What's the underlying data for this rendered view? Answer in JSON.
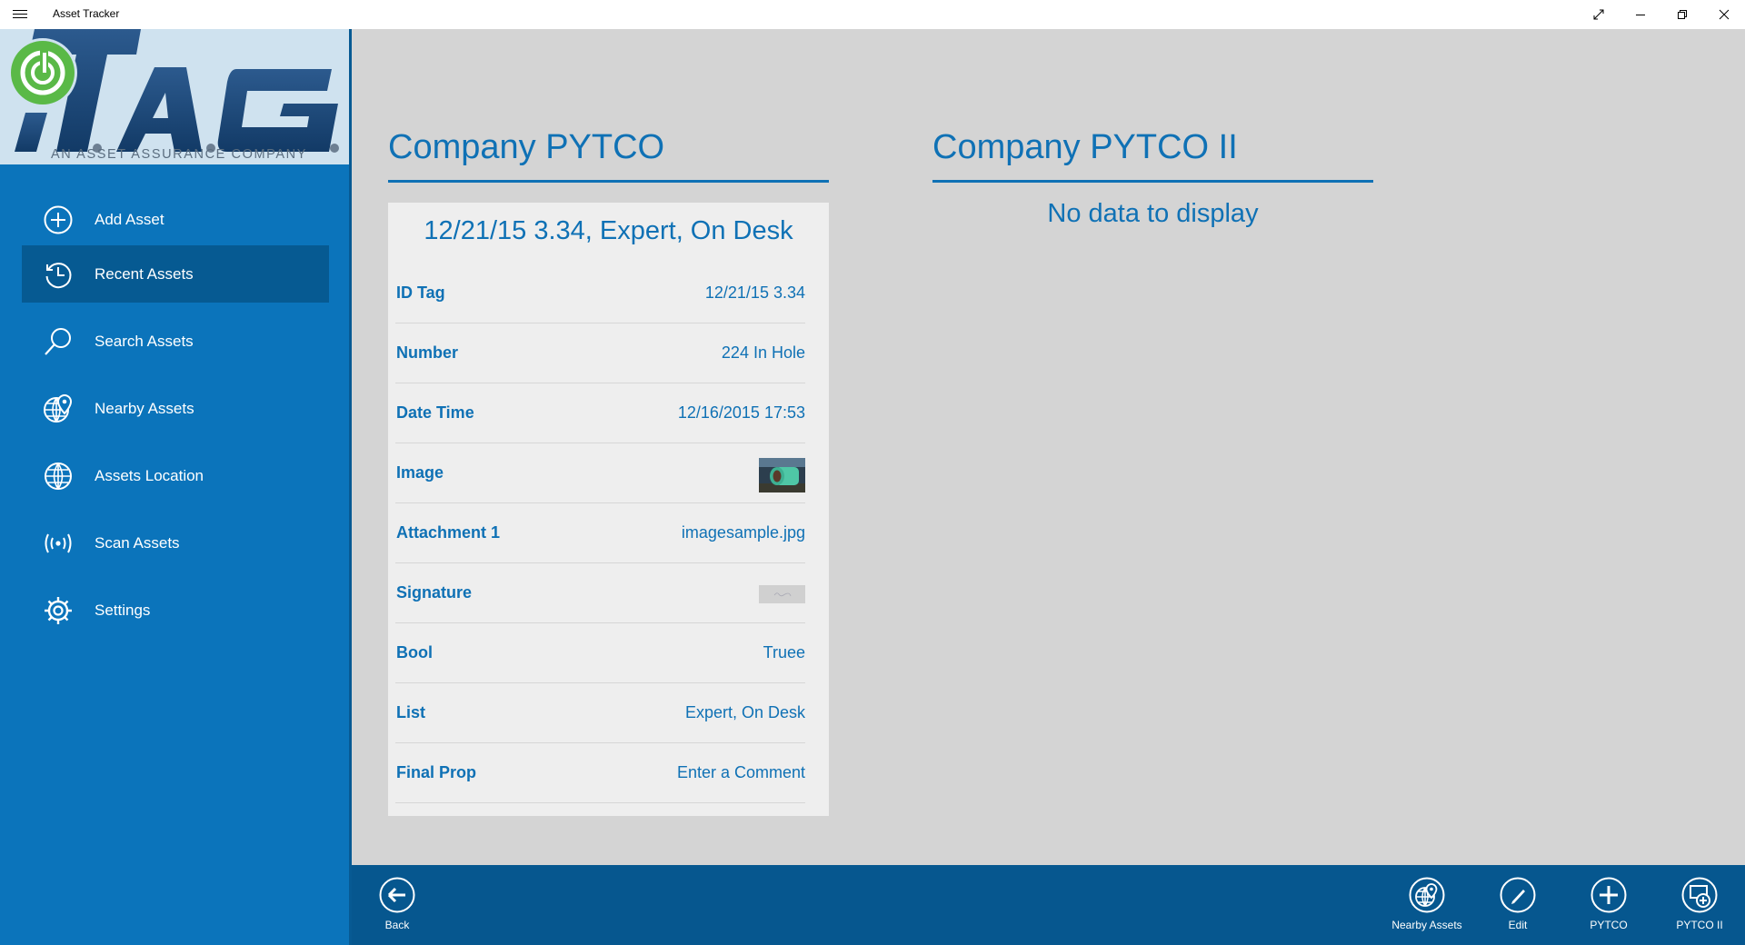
{
  "window": {
    "title": "Asset Tracker",
    "controls": [
      "expand-icon",
      "minimize-icon",
      "restore-icon",
      "close-icon"
    ]
  },
  "logo": {
    "brand": "iT.A.G.",
    "tagline": "AN ASSET ASSURANCE COMPANY"
  },
  "sidebar": {
    "items": [
      {
        "label": "Add Asset",
        "icon": "add-circle-icon",
        "active": false
      },
      {
        "label": "Recent Assets",
        "icon": "history-icon",
        "active": true
      },
      {
        "label": "Search Assets",
        "icon": "search-icon",
        "active": false
      },
      {
        "label": "Nearby Assets",
        "icon": "globe-pin-icon",
        "active": false
      },
      {
        "label": "Assets Location",
        "icon": "globe-icon",
        "active": false
      },
      {
        "label": "Scan Assets",
        "icon": "broadcast-icon",
        "active": false
      },
      {
        "label": "Settings",
        "icon": "gear-icon",
        "active": false
      }
    ]
  },
  "main": {
    "columns": [
      {
        "title": "Company PYTCO",
        "card": {
          "title": "12/21/15 3.34, Expert, On Desk",
          "rows": [
            {
              "key": "ID Tag",
              "value": "12/21/15 3.34",
              "type": "text"
            },
            {
              "key": "Number",
              "value": "224 In Hole",
              "type": "text"
            },
            {
              "key": "Date Time",
              "value": "12/16/2015 17:53",
              "type": "text"
            },
            {
              "key": "Image",
              "value": "",
              "type": "image"
            },
            {
              "key": "Attachment 1",
              "value": "imagesample.jpg",
              "type": "text"
            },
            {
              "key": "Signature",
              "value": "",
              "type": "signature"
            },
            {
              "key": "Bool",
              "value": "Truee",
              "type": "text"
            },
            {
              "key": "List",
              "value": "Expert, On Desk",
              "type": "text"
            },
            {
              "key": "Final Prop",
              "value": "Enter a Comment",
              "type": "text"
            }
          ]
        }
      },
      {
        "title": "Company PYTCO II",
        "empty_message": "No data to display"
      }
    ]
  },
  "appbar": {
    "back": {
      "label": "Back",
      "icon": "back-arrow-icon"
    },
    "buttons": [
      {
        "label": "Nearby Assets",
        "icon": "globe-pin-icon"
      },
      {
        "label": "Edit",
        "icon": "pencil-icon"
      },
      {
        "label": "PYTCO",
        "icon": "add-circle-icon"
      },
      {
        "label": "PYTCO II",
        "icon": "add-window-icon"
      }
    ]
  },
  "colors": {
    "sidebar": "#0b74bb",
    "sidebar_active": "#065a92",
    "appbar": "#06578f",
    "accent_text": "#0f71b5",
    "main_bg": "#d4d4d4",
    "card_bg": "#eeeeee"
  }
}
